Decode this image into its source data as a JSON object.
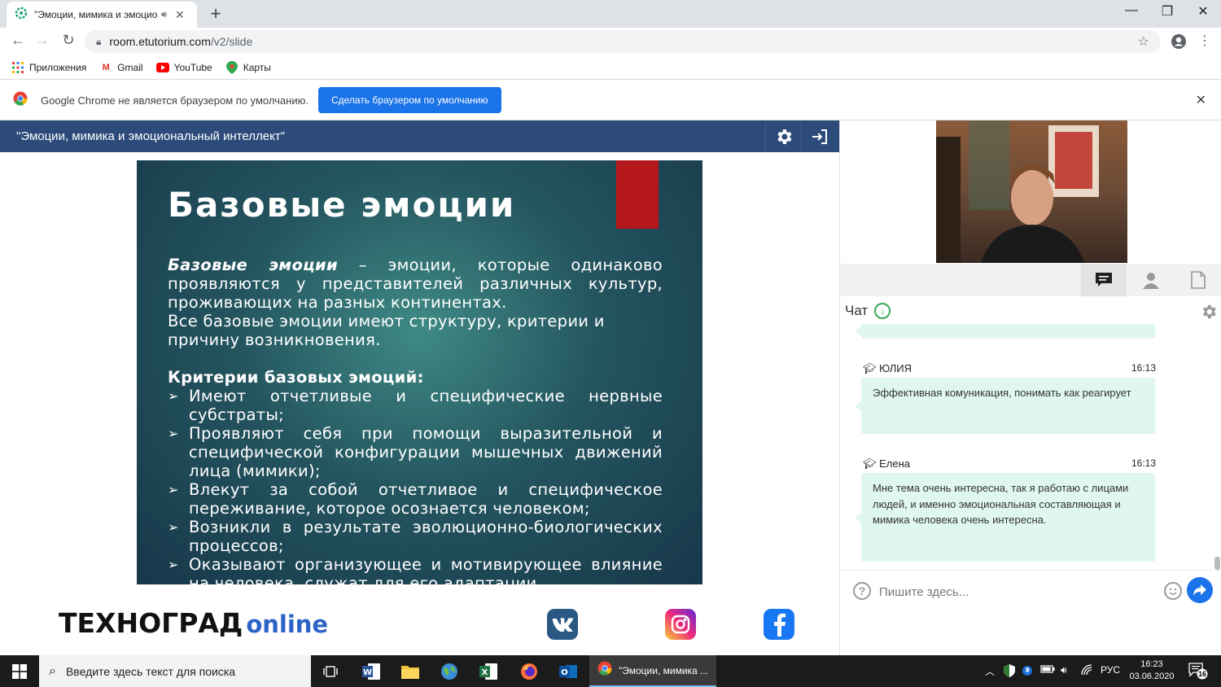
{
  "browser": {
    "tab_title": "\"Эмоции, мимика и эмоцио",
    "url_host": "room.etutorium.com",
    "url_path": "/v2/slide",
    "bookmarks": [
      {
        "label": "Приложения",
        "icon": "apps-grid-icon"
      },
      {
        "label": "Gmail",
        "icon": "gmail-icon"
      },
      {
        "label": "YouTube",
        "icon": "youtube-icon"
      },
      {
        "label": "Карты",
        "icon": "maps-icon"
      }
    ],
    "infobar": {
      "message": "Google Chrome не является браузером по умолчанию.",
      "button": "Сделать браузером по умолчанию"
    }
  },
  "app": {
    "header_title": "\"Эмоции, мимика и эмоциональный интеллект\""
  },
  "slide": {
    "title": "Базовые эмоции",
    "intro_term": "Базовые эмоции",
    "intro_rest": " – эмоции, которые одинаково проявляются у представителей различных культур, проживающих на разных континентах.",
    "intro2": "Все базовые эмоции имеют структуру, критерии и причину возникновения.",
    "criteria_title": "Критерии базовых эмоций:",
    "criteria": [
      "Имеют отчетливые и специфические нервные субстраты;",
      "Проявляют себя при помощи выразительной и специфической конфигурации мышечных движений лица (мимики);",
      "Влекут за собой отчетливое и специфическое переживание, которое осознается человеком;",
      "Возникли в результате эволюционно-биологических процессов;",
      "Оказывают организующее и мотивирующее влияние на человека, служат для его адаптации."
    ],
    "accent_color": "#b4181c"
  },
  "footer": {
    "brand_main": "ТЕХНОГРАД",
    "brand_suffix": "online"
  },
  "chat": {
    "label": "Чат",
    "messages": [
      {
        "author": "ЮЛИЯ",
        "time": "16:13",
        "text": "Эффективная комуникация, понимать как реагирует"
      },
      {
        "author": "Елена",
        "time": "16:13",
        "text": "Мне тема очень интересна, так я работаю с лицами людей, и именно эмоциональная составляющая и мимика человека очень интересна."
      }
    ],
    "input_placeholder": "Пишите здесь..."
  },
  "taskbar": {
    "search_placeholder": "Введите здесь текст для поиска",
    "active_app_label": "\"Эмоции, мимика ...",
    "lang": "РУС",
    "time": "16:23",
    "date": "03.06.2020",
    "notification_count": "16"
  }
}
